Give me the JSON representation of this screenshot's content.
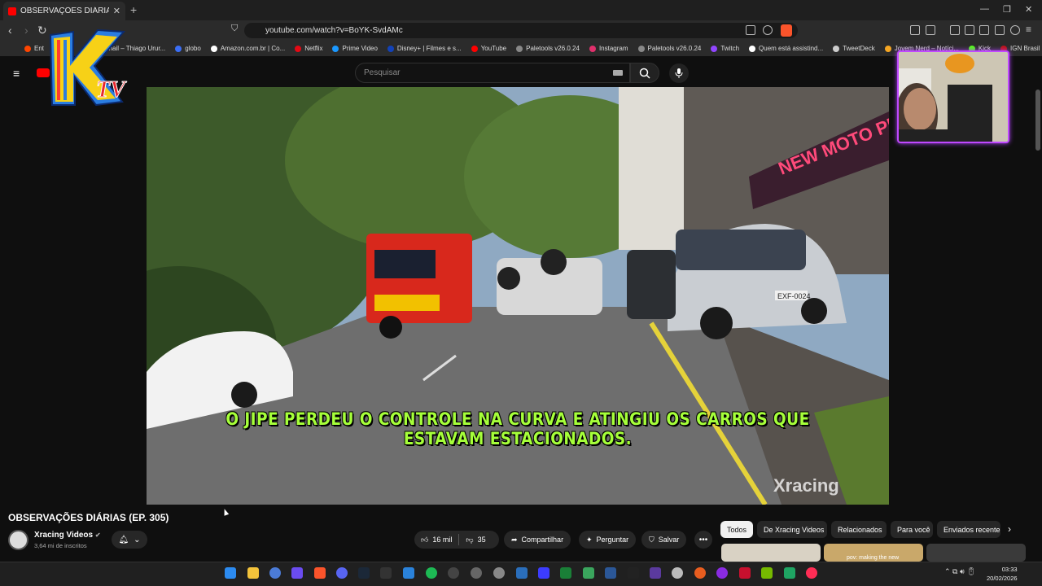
{
  "browser": {
    "tab_title": "OBSERVAÇÕES DIÁRIAS (EP. 3",
    "url": "youtube.com/watch?v=BoYK-SvdAMc",
    "bookmarks": [
      "Ent",
      "Email – Thiago Urur...",
      "globo",
      "Amazon.com.br | Co...",
      "Netflix",
      "Prime Video",
      "Disney+ | Filmes e s...",
      "YouTube",
      "Paletools v26.0.24",
      "Instagram",
      "Paletools v26.0.24",
      "Twitch",
      "Quem está assistind...",
      "TweetDeck",
      "Jovem Nerd – Notíci...",
      "Kick",
      "IGN Brasil"
    ]
  },
  "youtube": {
    "search_placeholder": "Pesquisar"
  },
  "overlay": {
    "logo_text": "KTV"
  },
  "video": {
    "subtitle": "O JIPE PERDEU O CONTROLE NA CURVA E ATINGIU OS CARROS QUE ESTAVAM ESTACIONADOS.",
    "sign_text": "NEW MOTO PEÇ",
    "plate_text": "EXF-0024",
    "watermark": "Xracing"
  },
  "meta": {
    "title": "OBSERVAÇÕES DIÁRIAS (EP. 305)",
    "channel": "Xracing Videos",
    "subscribers": "3,64 mi de inscritos",
    "likes": "16 mil",
    "dislikes": "35",
    "share_label": "Compartilhar",
    "ask_label": "Perguntar",
    "save_label": "Salvar"
  },
  "chips": [
    "Todos",
    "De Xracing Videos",
    "Relacionados",
    "Para você",
    "Enviados recentemente"
  ],
  "thumb_caption": "pov: making the new",
  "taskbar": {
    "time": "03:33",
    "date": "20/02/2026"
  },
  "colors": {
    "subtitle": "#a6ff3a",
    "youtube_red": "#ff0000",
    "webcam_border": "#c048ff"
  }
}
